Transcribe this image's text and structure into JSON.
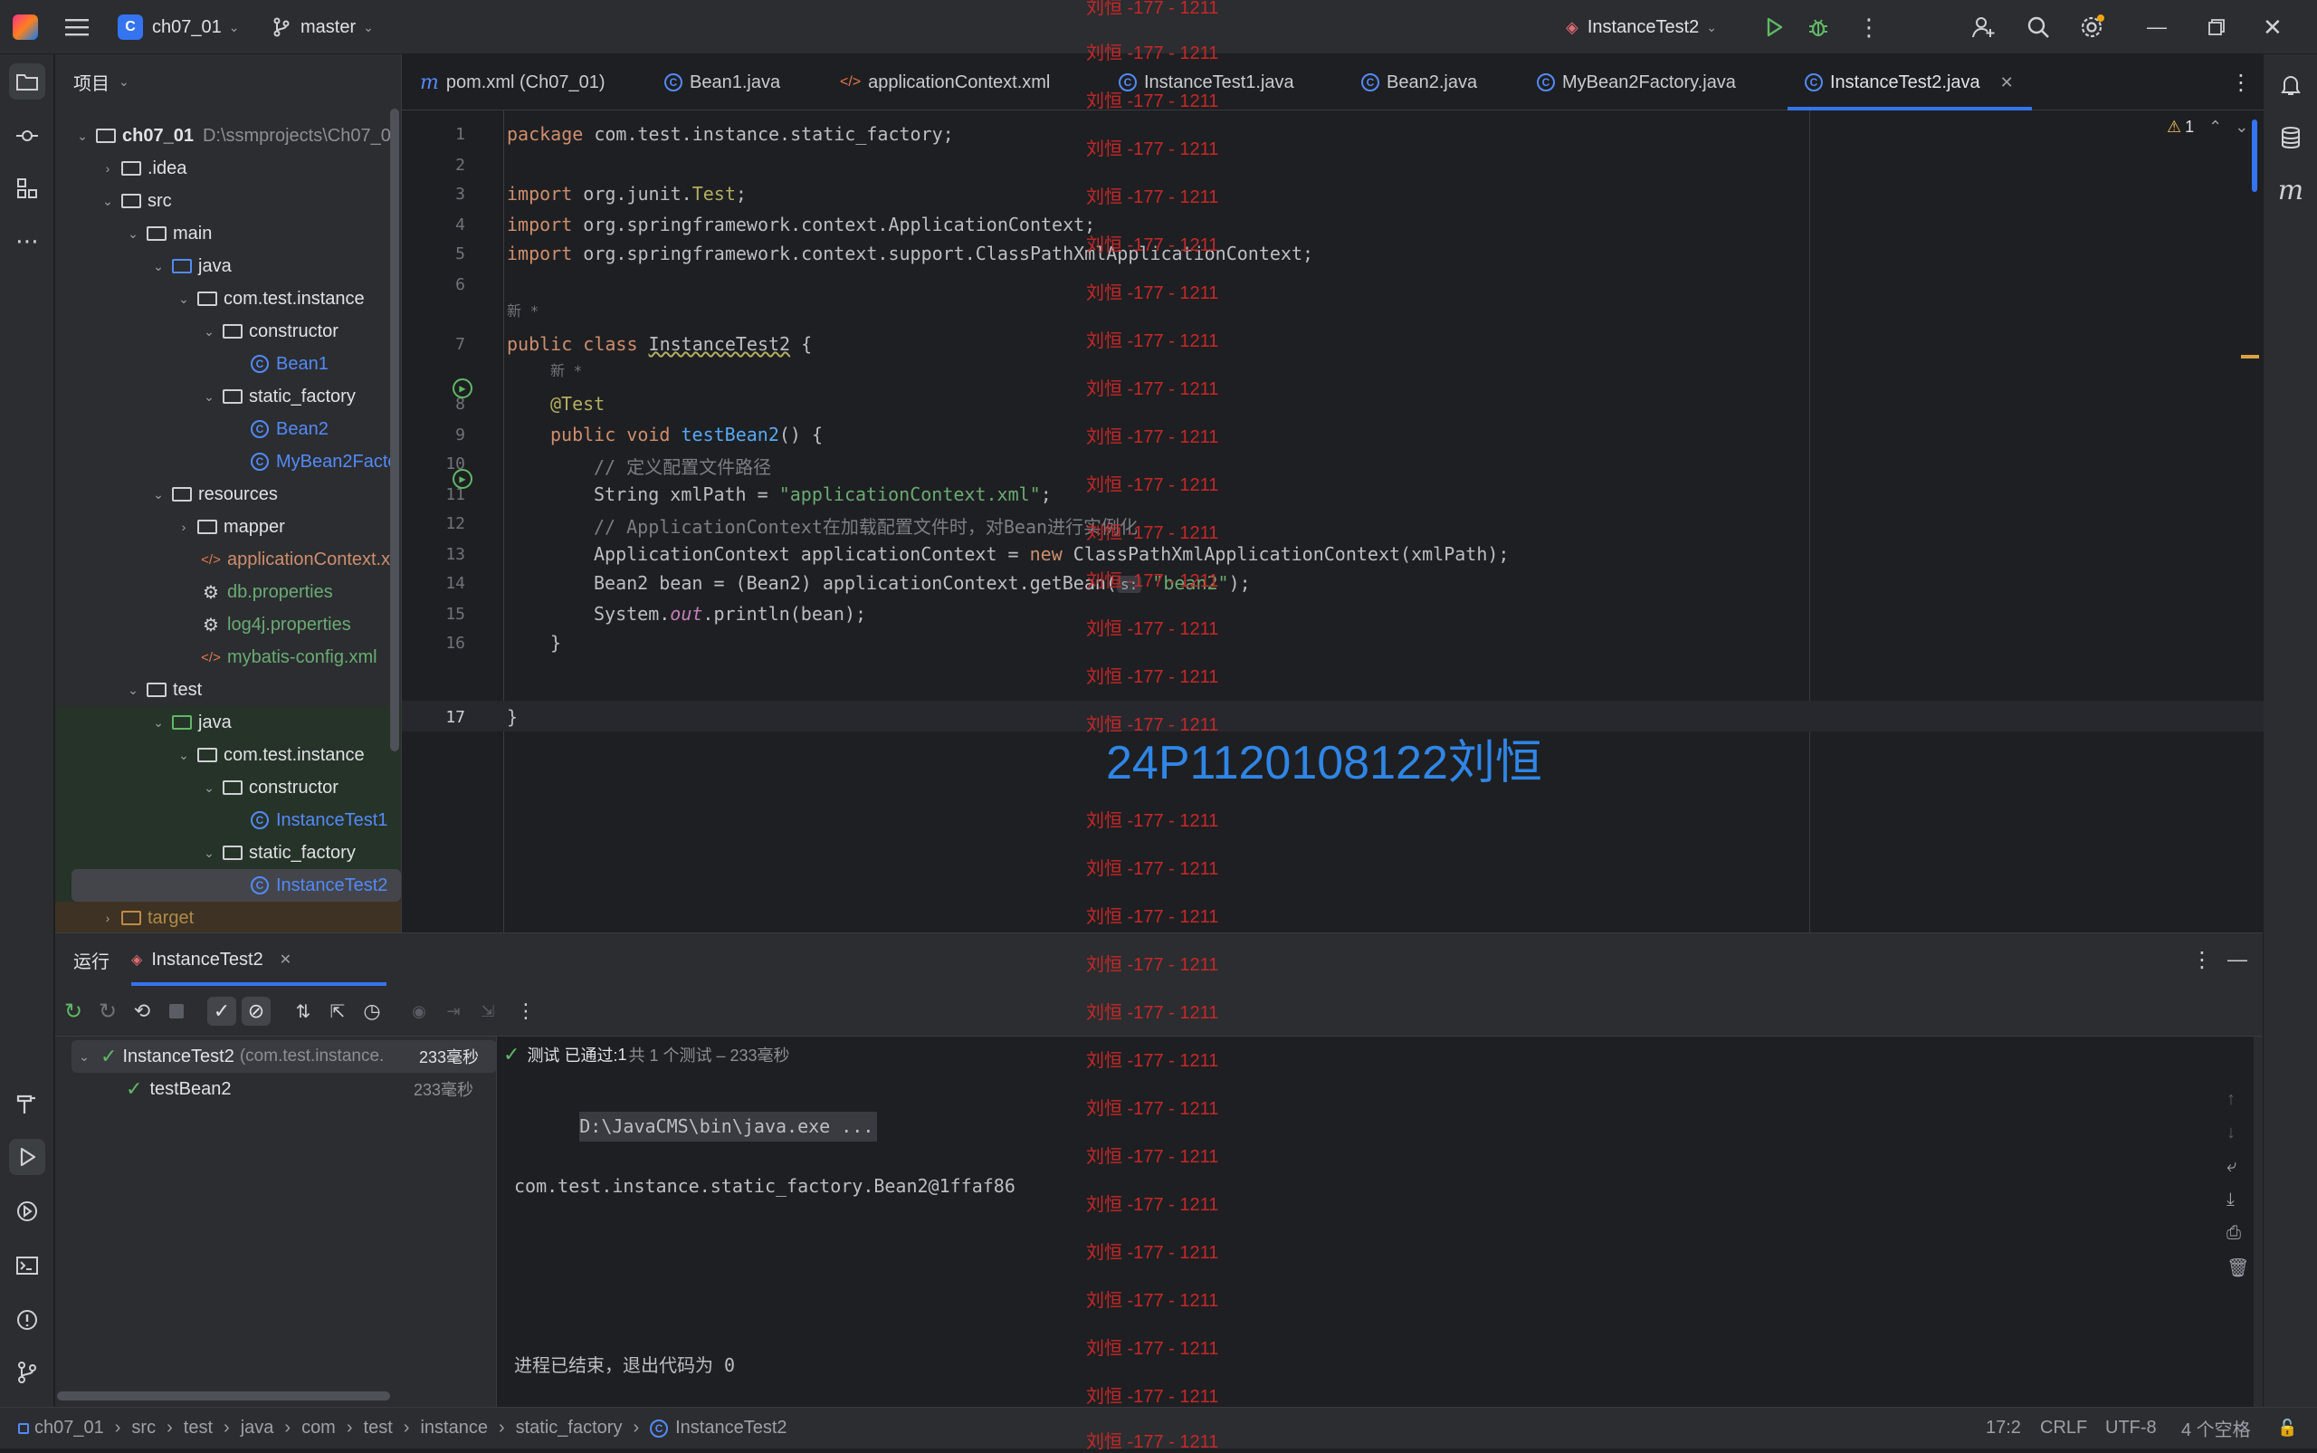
{
  "titlebar": {
    "project_badge": "C",
    "project": "ch07_01",
    "branch": "master",
    "run_config": "InstanceTest2"
  },
  "project_panel": {
    "title": "项目",
    "root": {
      "name": "ch07_01",
      "path": "D:\\ssmprojects\\Ch07_0"
    },
    "items": [
      {
        "label": ".idea"
      },
      {
        "label": "src"
      },
      {
        "label": "main"
      },
      {
        "label": "java"
      },
      {
        "label": "com.test.instance"
      },
      {
        "label": "constructor"
      },
      {
        "label": "Bean1"
      },
      {
        "label": "static_factory"
      },
      {
        "label": "Bean2"
      },
      {
        "label": "MyBean2Facto"
      },
      {
        "label": "resources"
      },
      {
        "label": "mapper"
      },
      {
        "label": "applicationContext.x"
      },
      {
        "label": "db.properties"
      },
      {
        "label": "log4j.properties"
      },
      {
        "label": "mybatis-config.xml"
      },
      {
        "label": "test"
      },
      {
        "label": "java"
      },
      {
        "label": "com.test.instance"
      },
      {
        "label": "constructor"
      },
      {
        "label": "InstanceTest1"
      },
      {
        "label": "static_factory"
      },
      {
        "label": "InstanceTest2"
      },
      {
        "label": "target"
      }
    ]
  },
  "tabs": [
    {
      "label": "pom.xml (Ch07_01)"
    },
    {
      "label": "Bean1.java"
    },
    {
      "label": "applicationContext.xml"
    },
    {
      "label": "InstanceTest1.java"
    },
    {
      "label": "Bean2.java"
    },
    {
      "label": "MyBean2Factory.java"
    },
    {
      "label": "InstanceTest2.java"
    }
  ],
  "editor": {
    "warning_count": "1",
    "line_numbers": [
      "1",
      "2",
      "3",
      "4",
      "5",
      "6",
      "7",
      "8",
      "9",
      "10",
      "11",
      "12",
      "13",
      "14",
      "15",
      "16",
      "17"
    ],
    "hint_new": "新 *",
    "code": {
      "l1_kw": "package",
      "l1": " com.test.instance.static_factory;",
      "l3_kw": "import",
      "l3_a": " org.junit.",
      "l3_b": "Test",
      "l3_c": ";",
      "l4_kw": "import",
      "l4": " org.springframework.context.ApplicationContext;",
      "l5_kw": "import",
      "l5": " org.springframework.context.support.ClassPathXmlApplicationContext;",
      "l7_kw": "public class",
      "l7_name": "InstanceTest2",
      "l7_b": " {",
      "l8": "@Test",
      "l9_kw": "public void",
      "l9_fn": "testBean2",
      "l9_b": "() {",
      "l10": "// 定义配置文件路径",
      "l11_a": "String xmlPath = ",
      "l11_str": "\"applicationContext.xml\"",
      "l11_b": ";",
      "l12": "// ApplicationContext在加载配置文件时，对Bean进行实例化",
      "l13_a": "ApplicationContext applicationContext = ",
      "l13_kw": "new",
      "l13_b": " ClassPathXmlApplicationContext(xmlPath);",
      "l14_a": "Bean2 bean = (Bean2) applicationContext.getBean(",
      "l14_hint": "s:",
      "l14_str": " \"bean2\"",
      "l14_b": ");",
      "l15_a": "System.",
      "l15_it": "out",
      "l15_b": ".println(bean);",
      "l16": "}",
      "l17": "}"
    }
  },
  "run_panel": {
    "title": "运行",
    "tab": "InstanceTest2",
    "tree": {
      "root": "InstanceTest2",
      "root_pkg": "(com.test.instance.",
      "root_time": "233毫秒",
      "child": "testBean2",
      "child_time": "233毫秒"
    },
    "status_a": "测试 已通过: ",
    "status_b": "1",
    "status_c": "共 1 个测试 – 233毫秒",
    "console": [
      "D:\\JavaCMS\\bin\\java.exe ...",
      "com.test.instance.static_factory.Bean2@1ffaf86",
      "",
      "进程已结束，退出代码为 0"
    ]
  },
  "statusbar": {
    "breadcrumb": [
      "ch07_01",
      "src",
      "test",
      "java",
      "com",
      "test",
      "instance",
      "static_factory",
      "InstanceTest2"
    ],
    "position": "17:2",
    "line_sep": "CRLF",
    "encoding": "UTF-8",
    "indent": "4 个空格"
  },
  "watermark": {
    "repeated": "刘恒 -177 - 1211",
    "big": "24P1120108122刘恒"
  },
  "colors": {
    "accent": "#3574f0",
    "pass": "#5fb865",
    "watermark_red": "#c62828",
    "watermark_blue": "#2f86e6"
  }
}
